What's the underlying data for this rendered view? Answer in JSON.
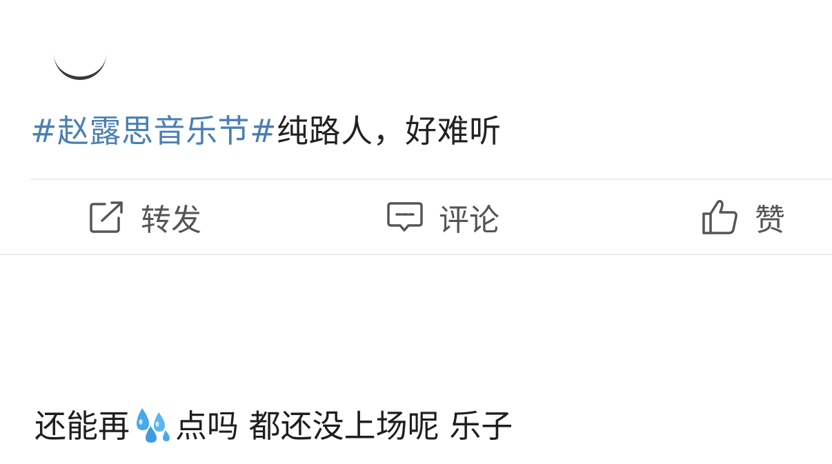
{
  "post": {
    "hashtag": "#赵露思音乐节#",
    "text": "纯路人，好难听"
  },
  "actions": {
    "repost_label": "转发",
    "comment_label": "评论",
    "like_label": "赞"
  },
  "comment": {
    "text_before": "还能再",
    "emoji_icon": "sweat-droplets-icon",
    "text_after": "点吗 都还没上场呢 乐子"
  },
  "colors": {
    "hashtag": "#4a7fb5",
    "icon": "#555555",
    "emoji": "#4aa8e8"
  }
}
